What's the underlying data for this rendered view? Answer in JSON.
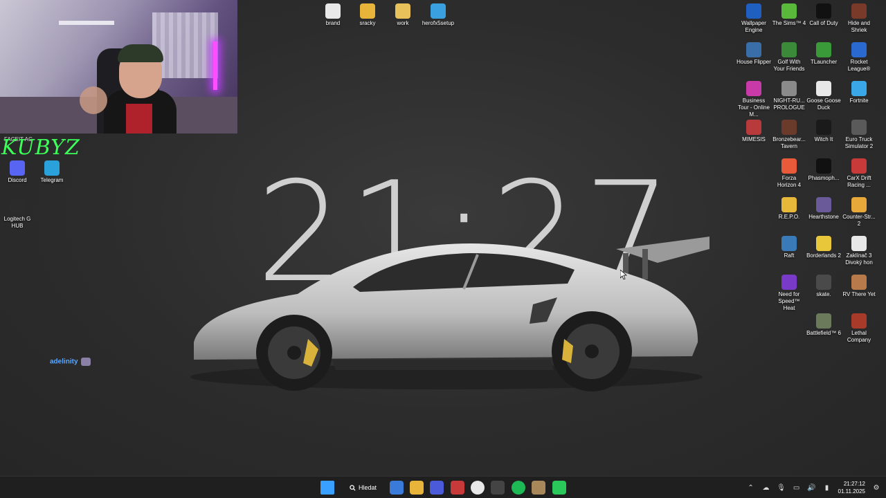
{
  "wallpaper": {
    "clock_text": "21:27"
  },
  "webcam": {
    "overlay_label": "FACEIT AG",
    "logo_text": "KUBYZ"
  },
  "left_icons": [
    {
      "label": "Discord",
      "icon": "discord-icon",
      "color": "#5865f2"
    },
    {
      "label": "Telegram",
      "icon": "telegram-icon",
      "color": "#2aa1da"
    },
    {
      "label": "Logitech G HUB",
      "icon": "logitech-icon",
      "color": "#2b2b2b"
    }
  ],
  "top_icons": [
    {
      "label": "brand",
      "icon": "file-icon",
      "color": "#e9e9e9"
    },
    {
      "label": "sracky",
      "icon": "folder-icon",
      "color": "#e8b53a"
    },
    {
      "label": "work",
      "icon": "folder-icon",
      "color": "#e8c15a"
    },
    {
      "label": "herofx5setup",
      "icon": "installer-icon",
      "color": "#3aa0e0"
    }
  ],
  "right_icons": [
    {
      "label": "Wallpaper Engine",
      "icon": "wallpaper-engine-icon",
      "color": "#1f5fbf"
    },
    {
      "label": "The Sims™ 4",
      "icon": "sims-icon",
      "color": "#5ab83a"
    },
    {
      "label": "Call of Duty",
      "icon": "cod-icon",
      "color": "#111111"
    },
    {
      "label": "Hide and Shriek",
      "icon": "hide-shriek-icon",
      "color": "#7a3a2a"
    },
    {
      "label": "House Flipper",
      "icon": "house-flipper-icon",
      "color": "#3a6ea8"
    },
    {
      "label": "Golf With Your Friends",
      "icon": "golf-icon",
      "color": "#3a8a3a"
    },
    {
      "label": "TLauncher",
      "icon": "tlauncher-icon",
      "color": "#3a9a3a"
    },
    {
      "label": "Rocket League®",
      "icon": "rocket-league-icon",
      "color": "#2a6ad0"
    },
    {
      "label": "Business Tour - Online M...",
      "icon": "business-tour-icon",
      "color": "#c83aa8"
    },
    {
      "label": "NIGHT-RU... PROLOGUE",
      "icon": "night-run-icon",
      "color": "#8a8a8a"
    },
    {
      "label": "Goose Goose Duck",
      "icon": "goose-icon",
      "color": "#e8e8e8"
    },
    {
      "label": "Fortnite",
      "icon": "fortnite-icon",
      "color": "#3aa8e8"
    },
    {
      "label": "MIMESIS",
      "icon": "mimesis-icon",
      "color": "#b83a3a"
    },
    {
      "label": "Bronzebear... Tavern",
      "icon": "tavern-icon",
      "color": "#6a3a2a"
    },
    {
      "label": "Witch It",
      "icon": "epic-icon",
      "color": "#1a1a1a"
    },
    {
      "label": "Euro Truck Simulator 2",
      "icon": "truck-icon",
      "color": "#5a5a5a"
    },
    {
      "label": "Forza Horizon 4",
      "icon": "forza-icon",
      "color": "#e85a3a"
    },
    {
      "label": "Phasmoph...",
      "icon": "phasmophobia-icon",
      "color": "#111111"
    },
    {
      "label": "CarX Drift Racing ...",
      "icon": "carx-icon",
      "color": "#c83a3a"
    },
    {
      "label": "R.E.P.O.",
      "icon": "repo-icon",
      "color": "#e8b83a"
    },
    {
      "label": "Hearthstone",
      "icon": "hearthstone-icon",
      "color": "#6a5a9a"
    },
    {
      "label": "Counter-Str... 2",
      "icon": "cs2-icon",
      "color": "#e8a83a"
    },
    {
      "label": "Raft",
      "icon": "raft-icon",
      "color": "#3a7ab8"
    },
    {
      "label": "Borderlands 2",
      "icon": "borderlands-icon",
      "color": "#e8c83a"
    },
    {
      "label": "Zaklínač 3 Divoký hon",
      "icon": "witcher-icon",
      "color": "#e8e8e8"
    },
    {
      "label": "Need for Speed™ Heat",
      "icon": "nfs-icon",
      "color": "#7a3ac8"
    },
    {
      "label": "skate.",
      "icon": "skate-icon",
      "color": "#4a4a4a"
    },
    {
      "label": "RV There Yet",
      "icon": "rv-icon",
      "color": "#b87a4a"
    },
    {
      "label": "Battlefield™ 6",
      "icon": "battlefield-icon",
      "color": "#6a7a5a"
    },
    {
      "label": "Lethal Company",
      "icon": "lethal-company-icon",
      "color": "#a83a2a"
    }
  ],
  "user_tag": {
    "name": "adelinity"
  },
  "taskbar": {
    "search_label": "Hledat",
    "apps": [
      {
        "name": "windows-start-icon",
        "color": "#3aa0ff"
      },
      {
        "name": "store-icon",
        "color": "#3a7ad8"
      },
      {
        "name": "file-explorer-icon",
        "color": "#e8b53a"
      },
      {
        "name": "app-blue-icon",
        "color": "#4a5ad8"
      },
      {
        "name": "stream-deck-icon",
        "color": "#c83a3a"
      },
      {
        "name": "chrome-icon",
        "color": "#e8e8e8"
      },
      {
        "name": "obs-icon",
        "color": "#444444"
      },
      {
        "name": "spotify-icon",
        "color": "#1db954"
      },
      {
        "name": "app-tan-icon",
        "color": "#a8885a"
      },
      {
        "name": "app-green-icon",
        "color": "#2ac85a"
      }
    ],
    "time": "21:27:12",
    "date": "01.11.2025"
  }
}
